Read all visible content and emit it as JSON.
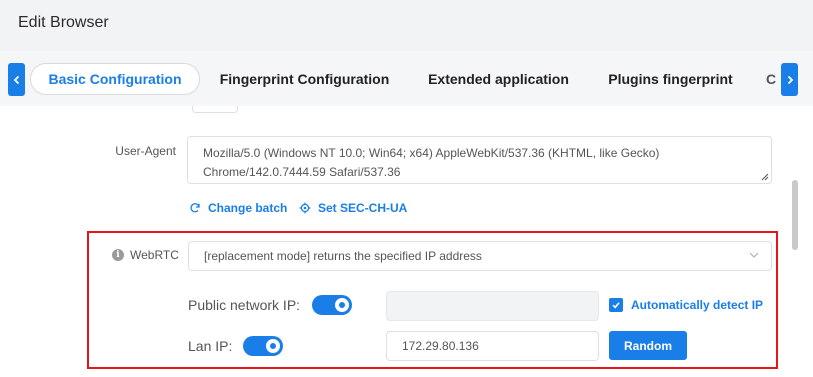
{
  "header": {
    "title": "Edit Browser"
  },
  "tabs": [
    {
      "label": "Basic Configuration",
      "active": true
    },
    {
      "label": "Fingerprint Configuration",
      "active": false
    },
    {
      "label": "Extended application",
      "active": false
    },
    {
      "label": "Plugins fingerprint",
      "active": false
    },
    {
      "label": "C",
      "active": false
    }
  ],
  "user_agent": {
    "label": "User-Agent",
    "value": "Mozilla/5.0 (Windows NT 10.0; Win64; x64) AppleWebKit/537.36 (KHTML, like Gecko) Chrome/142.0.7444.59 Safari/537.36"
  },
  "actions": {
    "change_batch": "Change batch",
    "set_sec_ch_ua": "Set SEC-CH-UA"
  },
  "webrtc": {
    "label": "WebRTC",
    "selected": "[replacement mode] returns the specified IP address",
    "public_ip_label": "Public network IP:",
    "public_ip_enabled": true,
    "public_ip_value": "",
    "auto_detect_label": "Automatically detect IP",
    "auto_detect_checked": true,
    "lan_ip_label": "Lan IP:",
    "lan_ip_enabled": true,
    "lan_ip_value": "172.29.80.136",
    "random_label": "Random"
  },
  "colors": {
    "accent": "#1a7ee8",
    "highlight_border": "#e3171a"
  },
  "icons": [
    "chevron-left-icon",
    "chevron-right-icon",
    "refresh-icon",
    "gear-icon",
    "info-icon",
    "chevron-down-icon",
    "checkmark-icon",
    "resize-grip-icon"
  ]
}
